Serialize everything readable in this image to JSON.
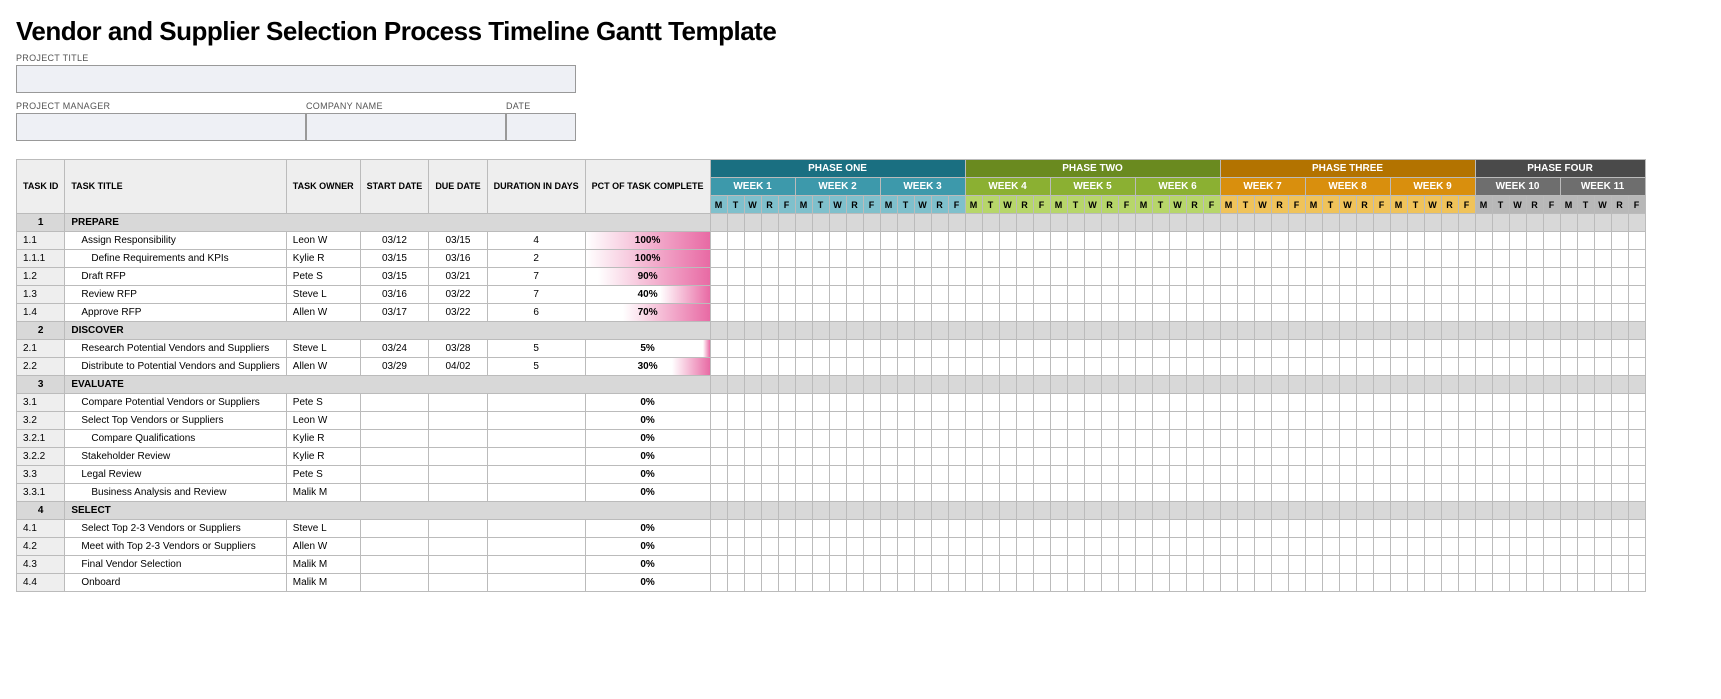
{
  "title": "Vendor and Supplier Selection Process Timeline Gantt Template",
  "fields": {
    "project_title_label": "PROJECT TITLE",
    "project_manager_label": "PROJECT MANAGER",
    "company_name_label": "COMPANY NAME",
    "date_label": "DATE",
    "project_title": "",
    "project_manager": "",
    "company_name": "",
    "date": ""
  },
  "columns": {
    "id": "TASK ID",
    "task": "TASK TITLE",
    "owner": "TASK OWNER",
    "start": "START DATE",
    "due": "DUE DATE",
    "duration": "DURATION IN DAYS",
    "pct": "PCT OF TASK COMPLETE"
  },
  "days": [
    "M",
    "T",
    "W",
    "R",
    "F"
  ],
  "phases": [
    {
      "name": "PHASE ONE",
      "palette": "ph1",
      "weeks": [
        "WEEK 1",
        "WEEK 2",
        "WEEK 3"
      ],
      "ambient_start": 5,
      "ambient_span": 3
    },
    {
      "name": "PHASE TWO",
      "palette": "ph2",
      "weeks": [
        "WEEK 4",
        "WEEK 5",
        "WEEK 6"
      ],
      "ambient_start": 5,
      "ambient_span": 5
    },
    {
      "name": "PHASE THREE",
      "palette": "ph3",
      "weeks": [
        "WEEK 7",
        "WEEK 8",
        "WEEK 9"
      ],
      "ambient_start": 5,
      "ambient_span": 3
    },
    {
      "name": "PHASE FOUR",
      "palette": "ph4",
      "weeks": [
        "WEEK 10",
        "WEEK 11"
      ],
      "ambient_start": 5,
      "ambient_span": 3
    }
  ],
  "rows": [
    {
      "type": "section",
      "id": "1",
      "title": "PREPARE"
    },
    {
      "type": "task",
      "id": "1.1",
      "indent": 1,
      "title": "Assign Responsibility",
      "owner": "Leon W",
      "start": "03/12",
      "due": "03/15",
      "duration": "4",
      "pct": 100,
      "bar_start": 2,
      "bar_span": 5
    },
    {
      "type": "task",
      "id": "1.1.1",
      "indent": 2,
      "title": "Define Requirements and KPIs",
      "owner": "Kylie R",
      "start": "03/15",
      "due": "03/16",
      "duration": "2",
      "pct": 100,
      "bar_start": 5,
      "bar_span": 2
    },
    {
      "type": "task",
      "id": "1.2",
      "indent": 1,
      "title": "Draft RFP",
      "owner": "Pete S",
      "start": "03/15",
      "due": "03/21",
      "duration": "7",
      "pct": 90,
      "bar_start": 5,
      "bar_span": 5
    },
    {
      "type": "task",
      "id": "1.3",
      "indent": 1,
      "title": "Review RFP",
      "owner": "Steve L",
      "start": "03/16",
      "due": "03/22",
      "duration": "7",
      "pct": 40,
      "bar_start": 6,
      "bar_span": 5
    },
    {
      "type": "task",
      "id": "1.4",
      "indent": 1,
      "title": "Approve RFP",
      "owner": "Allen W",
      "start": "03/17",
      "due": "03/22",
      "duration": "6",
      "pct": 70,
      "bar_start": 7,
      "bar_span": 9
    },
    {
      "type": "section",
      "id": "2",
      "title": "DISCOVER"
    },
    {
      "type": "task",
      "id": "2.1",
      "indent": 1,
      "title": "Research Potential Vendors and Suppliers",
      "owner": "Steve L",
      "start": "03/24",
      "due": "03/28",
      "duration": "5",
      "pct": 5,
      "bar_start": 16,
      "bar_span": 5
    },
    {
      "type": "task",
      "id": "2.2",
      "indent": 1,
      "title": "Distribute to Potential Vendors and Suppliers",
      "owner": "Allen W",
      "start": "03/29",
      "due": "04/02",
      "duration": "5",
      "pct": 30,
      "bar_start": 23,
      "bar_span": 2
    },
    {
      "type": "section",
      "id": "3",
      "title": "EVALUATE"
    },
    {
      "type": "task",
      "id": "3.1",
      "indent": 1,
      "title": "Compare Potential Vendors or Suppliers",
      "owner": "Pete S",
      "start": "",
      "due": "",
      "duration": "",
      "pct": 0,
      "bar_start": 31,
      "bar_span": 3
    },
    {
      "type": "task",
      "id": "3.2",
      "indent": 1,
      "title": "Select Top Vendors or Suppliers",
      "owner": "Leon W",
      "start": "",
      "due": "",
      "duration": "",
      "pct": 0,
      "bar_start": 35,
      "bar_span": 1
    },
    {
      "type": "task",
      "id": "3.2.1",
      "indent": 2,
      "title": "Compare Qualifications",
      "owner": "Kylie R",
      "start": "",
      "due": "",
      "duration": "",
      "pct": 0,
      "bar_start": 36,
      "bar_span": 3
    },
    {
      "type": "task",
      "id": "3.2.2",
      "indent": 1,
      "title": "Stakeholder Review",
      "owner": "Kylie R",
      "start": "",
      "due": "",
      "duration": "",
      "pct": 0,
      "bar_start": 37,
      "bar_span": 3
    },
    {
      "type": "task",
      "id": "3.3",
      "indent": 1,
      "title": "Legal Review",
      "owner": "Pete S",
      "start": "",
      "due": "",
      "duration": "",
      "pct": 0,
      "bar_start": 38,
      "bar_span": 3
    },
    {
      "type": "task",
      "id": "3.3.1",
      "indent": 2,
      "title": "Business Analysis and Review",
      "owner": "Malik M",
      "start": "",
      "due": "",
      "duration": "",
      "pct": 0,
      "bar_start": 39,
      "bar_span": 3
    },
    {
      "type": "section",
      "id": "4",
      "title": "SELECT"
    },
    {
      "type": "task",
      "id": "4.1",
      "indent": 1,
      "title": "Select Top 2-3 Vendors or Suppliers",
      "owner": "Steve L",
      "start": "",
      "due": "",
      "duration": "",
      "pct": 0,
      "bar_start": 47,
      "bar_span": 3
    },
    {
      "type": "task",
      "id": "4.2",
      "indent": 1,
      "title": "Meet with Top 2-3 Vendors or Suppliers",
      "owner": "Allen W",
      "start": "",
      "due": "",
      "duration": "",
      "pct": 0,
      "bar_start": 49,
      "bar_span": 3
    },
    {
      "type": "task",
      "id": "4.3",
      "indent": 1,
      "title": "Final Vendor Selection",
      "owner": "Malik M",
      "start": "",
      "due": "",
      "duration": "",
      "pct": 0
    },
    {
      "type": "task",
      "id": "4.4",
      "indent": 1,
      "title": "Onboard",
      "owner": "Malik M",
      "start": "",
      "due": "",
      "duration": "",
      "pct": 0
    }
  ]
}
